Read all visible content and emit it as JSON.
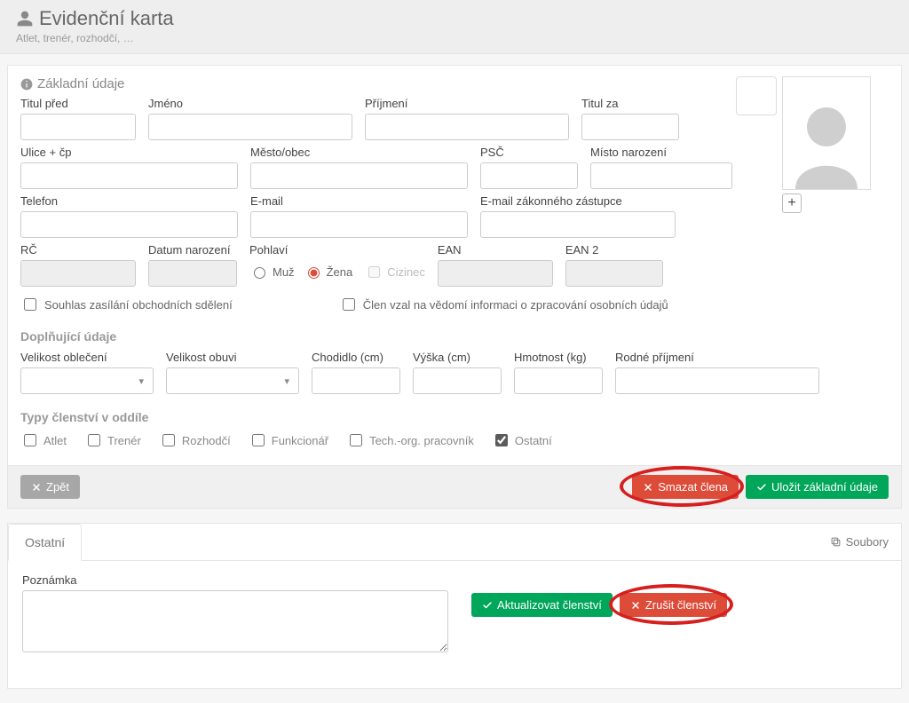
{
  "header": {
    "title": "Evidenční karta",
    "subtitle": "Atlet, trenér, rozhodčí, …"
  },
  "section1": {
    "title": "Základní údaje",
    "labels": {
      "titul_pred": "Titul před",
      "jmeno": "Jméno",
      "prijmeni": "Příjmení",
      "titul_za": "Titul za",
      "ulice": "Ulice + čp",
      "mesto": "Město/obec",
      "psc": "PSČ",
      "misto_nar": "Místo narození",
      "telefon": "Telefon",
      "email": "E-mail",
      "email_zz": "E-mail zákonného zástupce",
      "rc": "RČ",
      "datum_nar": "Datum narození",
      "pohlavi": "Pohlaví",
      "muz": "Muž",
      "zena": "Žena",
      "cizinec": "Cizinec",
      "ean": "EAN",
      "ean2": "EAN 2",
      "souhlas": "Souhlas zasílání obchodních sdělení",
      "clen_vzal": "Člen vzal na vědomí informaci o zpracování osobních údajů"
    },
    "addl_title": "Doplňující údaje",
    "addl": {
      "velikost_obl": "Velikost oblečení",
      "velikost_obuv": "Velikost obuvi",
      "chodidlo": "Chodidlo (cm)",
      "vyska": "Výška (cm)",
      "hmotnost": "Hmotnost (kg)",
      "rodne_prijmeni": "Rodné příjmení"
    },
    "types_title": "Typy členství v oddíle",
    "types": {
      "atlet": "Atlet",
      "trener": "Trenér",
      "rozhodci": "Rozhodčí",
      "funkcionar": "Funkcionář",
      "techorg": "Tech.-org. pracovník",
      "ostatni": "Ostatní"
    },
    "checked_type": "ostatni",
    "selected_gender": "zena"
  },
  "footer_buttons": {
    "back": "Zpět",
    "delete_member": "Smazat člena",
    "save": "Uložit základní údaje"
  },
  "panel2": {
    "tab": "Ostatní",
    "files_link": "Soubory",
    "note_label": "Poznámka",
    "update_btn": "Aktualizovat členství",
    "cancel_btn": "Zrušit členství"
  }
}
